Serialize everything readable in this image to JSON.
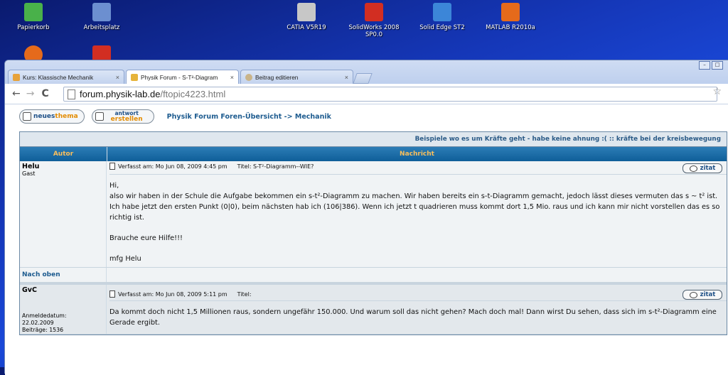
{
  "desktop": {
    "icons": [
      {
        "label": "Papierkorb",
        "color": "#49b14a"
      },
      {
        "label": "Arbeitsplatz",
        "color": "#6c8fd0"
      },
      {
        "label": "CATIA V5R19",
        "color": "#c7c7c7"
      },
      {
        "label": "SolidWorks 2008 SP0.0",
        "color": "#d22e22"
      },
      {
        "label": "Solid Edge ST2",
        "color": "#3c86d8"
      },
      {
        "label": "MATLAB R2010a",
        "color": "#e56a1b"
      }
    ]
  },
  "browser": {
    "tabs": [
      {
        "label": "Kurs: Klassische Mechanik",
        "close": "×"
      },
      {
        "label": "Physik Forum - S-T²-Diagram",
        "close": "×"
      },
      {
        "label": "Beitrag editieren",
        "close": "×"
      }
    ],
    "url_host": "forum.physik-lab.de",
    "url_path": "/ftopic4223.html",
    "back": "←",
    "forward": "→",
    "reload": "C",
    "star": "☆",
    "min": "–",
    "max": "□"
  },
  "forum": {
    "new_topic_pre": "neues",
    "new_topic_hl": "thema",
    "reply_line1": "antwort",
    "reply_line2": "erstellen",
    "breadcrumb": "Physik Forum Foren-Übersicht -> Mechanik",
    "topic_bar": "Beispiele wo es um Kräfte geht - habe keine ahnung :(  ::  kräfte bei der kreisbewegung",
    "col_author": "Autor",
    "col_message": "Nachricht",
    "quote_label": "zitat",
    "back_to_top": "Nach oben",
    "posts": [
      {
        "author": "Helu",
        "role": "Gast",
        "posted": "Verfasst am: Mo Jun 08, 2009 4:45 pm",
        "title": "Titel: S-T²-Diagramm--WIE?",
        "lines": [
          "Hi,",
          "also wir haben in der Schule die Aufgabe bekommen ein s-t²-Diagramm zu machen. Wir haben bereits ein s-t-Diagramm gemacht, jedoch lässt dieses vermuten das s ~ t² ist.",
          "Ich habe jetzt den ersten Punkt (0|0), beim nächsten hab ich (106|386). Wenn ich jetzt t quadrieren muss kommt dort 1,5 Mio. raus und ich kann mir nicht vorstellen das es so richtig ist.",
          "",
          "Brauche eure Hilfe!!!",
          "",
          "mfg Helu"
        ]
      },
      {
        "author": "GvC",
        "reg_label": "Anmeldedatum:",
        "reg_date": "22.02.2009",
        "posts_count": "Beiträge: 1536",
        "posted": "Verfasst am: Mo Jun 08, 2009 5:11 pm",
        "title": "Titel:",
        "lines": [
          "Da kommt doch nicht 1,5 Millionen raus, sondern ungefähr 150.000. Und warum soll das nicht gehen? Mach doch mal! Dann wirst Du sehen, dass sich im s-t²-Diagramm eine Gerade ergibt."
        ]
      }
    ]
  }
}
